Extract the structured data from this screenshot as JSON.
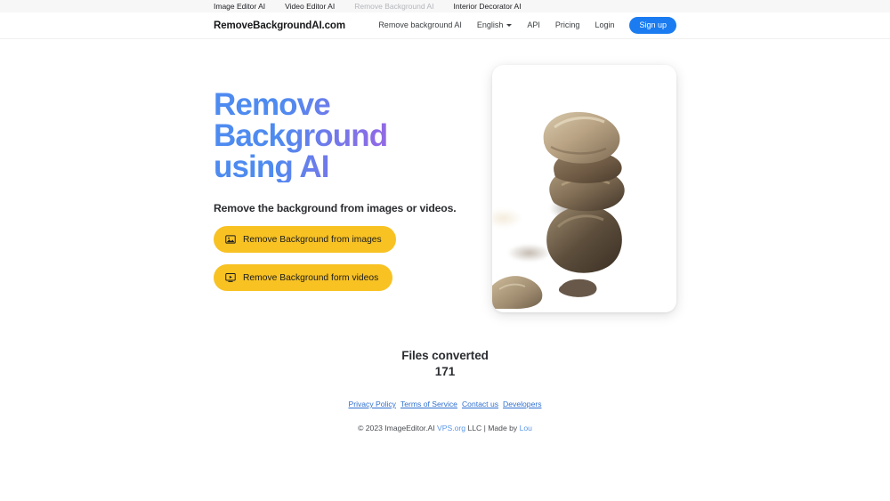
{
  "topbar": {
    "links": [
      {
        "label": "Image Editor AI",
        "muted": false
      },
      {
        "label": "Video Editor AI",
        "muted": false
      },
      {
        "label": "Remove Background AI",
        "muted": true
      },
      {
        "label": "Interior Decorator AI",
        "muted": false
      }
    ]
  },
  "header": {
    "brand": "RemoveBackgroundAI.com",
    "nav": {
      "remove_bg": "Remove background AI",
      "language": "English",
      "api": "API",
      "pricing": "Pricing",
      "login": "Login",
      "signup": "Sign up"
    }
  },
  "hero": {
    "headline": "Remove Background using AI",
    "subheadline": "Remove the background from images or videos.",
    "buttons": [
      {
        "label": "Remove Background from images",
        "icon": "image-icon"
      },
      {
        "label": "Remove Background form videos",
        "icon": "video-display-icon"
      }
    ],
    "image_card": {
      "alt": "Stacked rock cairn before and after background removal",
      "left_state": "with-background",
      "right_state": "background-removed"
    }
  },
  "stats": {
    "label": "Files converted",
    "value": "171"
  },
  "footer": {
    "links": [
      "Privacy Policy",
      "Terms of Service",
      "Contact us",
      "Developers"
    ],
    "copyright_pre": "© 2023 ImageEditor.AI",
    "copyright_link1": "VPS.org",
    "copyright_mid": "LLC | Made by",
    "copyright_link2": "Lou"
  },
  "colors": {
    "accent_yellow": "#f8c223",
    "accent_blue": "#1a7cf0",
    "headline_gradient_start": "#4e8bf0",
    "headline_gradient_end": "#a96de2",
    "link_blue": "#2f6fd0"
  }
}
